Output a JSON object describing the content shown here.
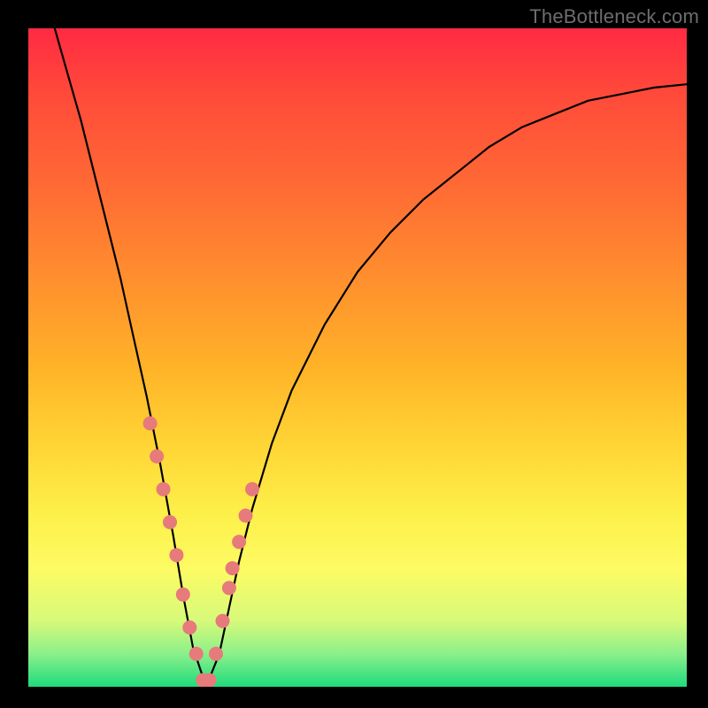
{
  "watermark": "TheBottleneck.com",
  "chart_data": {
    "type": "line",
    "title": "",
    "xlabel": "",
    "ylabel": "",
    "xlim": [
      0,
      1
    ],
    "ylim": [
      0,
      1
    ],
    "background_gradient": {
      "top": "#ff2a42",
      "bottom": "#1fdb7d"
    },
    "curve": {
      "description": "V-shaped bottleneck curve. y ≈ 1 at x≈0, drops steeply to y≈0 near x≈0.27, then rises with decreasing slope toward y≈0.9 at x=1.",
      "x": [
        0.04,
        0.06,
        0.08,
        0.1,
        0.12,
        0.14,
        0.16,
        0.18,
        0.2,
        0.22,
        0.235,
        0.25,
        0.27,
        0.29,
        0.305,
        0.32,
        0.34,
        0.37,
        0.4,
        0.45,
        0.5,
        0.55,
        0.6,
        0.65,
        0.7,
        0.75,
        0.8,
        0.85,
        0.9,
        0.95,
        1.0
      ],
      "y": [
        1.0,
        0.93,
        0.86,
        0.78,
        0.7,
        0.62,
        0.53,
        0.44,
        0.34,
        0.23,
        0.14,
        0.06,
        0.0,
        0.05,
        0.12,
        0.19,
        0.27,
        0.37,
        0.45,
        0.55,
        0.63,
        0.69,
        0.74,
        0.78,
        0.82,
        0.85,
        0.87,
        0.89,
        0.9,
        0.91,
        0.915
      ]
    },
    "markers": {
      "color": "#e77a7a",
      "points_x": [
        0.185,
        0.195,
        0.205,
        0.215,
        0.225,
        0.235,
        0.245,
        0.255,
        0.265,
        0.275,
        0.285,
        0.295,
        0.305,
        0.31,
        0.32,
        0.33,
        0.34
      ],
      "points_y": [
        0.4,
        0.35,
        0.3,
        0.25,
        0.2,
        0.14,
        0.09,
        0.05,
        0.01,
        0.01,
        0.05,
        0.1,
        0.15,
        0.18,
        0.22,
        0.26,
        0.3
      ]
    },
    "bottom_band": {
      "description": "very thin bright green strip at bottom of plot indicating optimal zone",
      "y_fraction": 0.985
    }
  }
}
